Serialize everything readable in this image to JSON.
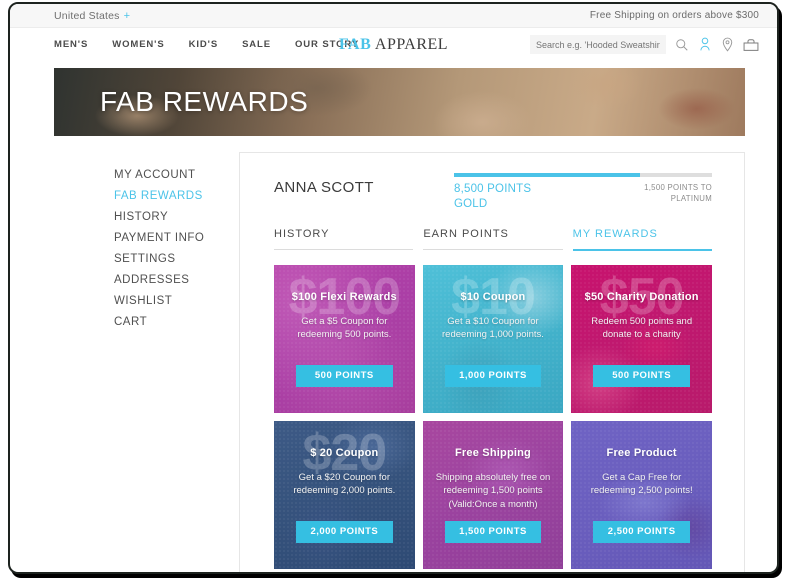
{
  "utility_bar": {
    "country": "United States",
    "country_plus": "+",
    "shipping_note": "Free Shipping on orders above $300"
  },
  "nav": {
    "links": [
      {
        "label": "MEN'S"
      },
      {
        "label": "WOMEN'S"
      },
      {
        "label": "KID'S"
      },
      {
        "label": "SALE"
      },
      {
        "label": "OUR STORY"
      }
    ],
    "logo_primary": "FAB",
    "logo_secondary": "APPAREL",
    "search_placeholder": "Search e.g. 'Hooded Sweatshirt'",
    "search_value": "",
    "icons": {
      "search": "search-icon",
      "account": "user-icon",
      "location": "map-pin-icon",
      "bag": "shopping-bag-icon"
    }
  },
  "hero": {
    "title": "FAB REWARDS"
  },
  "sidebar": {
    "items": [
      {
        "label": "MY ACCOUNT",
        "active": false
      },
      {
        "label": "FAB REWARDS",
        "active": true
      },
      {
        "label": "HISTORY",
        "active": false
      },
      {
        "label": "PAYMENT INFO",
        "active": false
      },
      {
        "label": "SETTINGS",
        "active": false
      },
      {
        "label": "ADDRESSES",
        "active": false
      },
      {
        "label": "WISHLIST",
        "active": false
      },
      {
        "label": "CART",
        "active": false
      }
    ]
  },
  "account": {
    "user_name": "ANNA SCOTT",
    "points_current": "8,500 POINTS",
    "tier": "GOLD",
    "points_to_next": "1,500 POINTS TO PLATINUM",
    "progress_percent": 72
  },
  "tabs": [
    {
      "label": "HISTORY",
      "active": false
    },
    {
      "label": "EARN POINTS",
      "active": false
    },
    {
      "label": "MY REWARDS",
      "active": true
    }
  ],
  "rewards": [
    {
      "watermark": "$100",
      "title": "$100 Flexi Rewards",
      "description": "Get a $5 Coupon for redeeming 500 points.",
      "button": "500 POINTS",
      "theme": "bg-flexi"
    },
    {
      "watermark": "$10",
      "title": "$10 Coupon",
      "description": "Get a $10 Coupon for redeeming 1,000 points.",
      "button": "1,000 POINTS",
      "theme": "bg-coupon10"
    },
    {
      "watermark": "$50",
      "title": "$50 Charity Donation",
      "description": "Redeem 500 points and donate to a charity",
      "button": "500 POINTS",
      "theme": "bg-charity"
    },
    {
      "watermark": "$20",
      "title": "$ 20 Coupon",
      "description": "Get a $20 Coupon for redeeming 2,000 points.",
      "button": "2,000 POINTS",
      "theme": "bg-coupon20"
    },
    {
      "watermark": "",
      "title": "Free Shipping",
      "description": "Shipping absolutely free on redeeming 1,500 points (Valid:Once a month)",
      "button": "1,500 POINTS",
      "theme": "bg-shipping"
    },
    {
      "watermark": "",
      "title": "Free Product",
      "description": "Get a Cap Free for redeeming 2,500 points!",
      "button": "2,500 POINTS",
      "theme": "bg-product"
    }
  ],
  "colors": {
    "accent": "#4bc3e8",
    "button": "#35bfe2",
    "text_dark": "#3a3a3a"
  }
}
